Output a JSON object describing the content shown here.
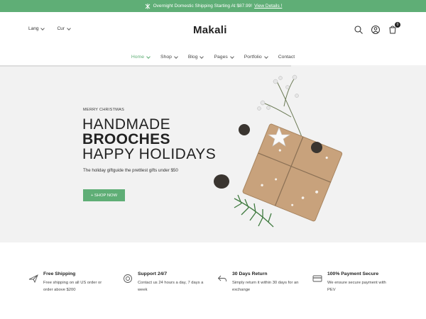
{
  "topbar": {
    "text": "Overnight Domestic Shipping Starting At $87.99!",
    "link": "View Details !"
  },
  "header": {
    "lang_label": "Lang",
    "cur_label": "Cur",
    "logo": "Makali",
    "cart_count": "0"
  },
  "nav": {
    "items": [
      {
        "label": "Home"
      },
      {
        "label": "Shop"
      },
      {
        "label": "Blog"
      },
      {
        "label": "Pages"
      },
      {
        "label": "Portfolio"
      },
      {
        "label": "Contact"
      }
    ]
  },
  "hero": {
    "eyebrow": "MERRY CHRISTMAS",
    "line1": "HANDMADE",
    "line2": "BROOCHES",
    "line3": "HAPPY HOLIDAYS",
    "subtitle": "The holiday giftguide the prettlest gifts under $50",
    "cta": "+ SHOP NOW"
  },
  "features": [
    {
      "title": "Free Shipping",
      "desc": "Free shipping on all US order or order above $200",
      "icon": "plane-icon"
    },
    {
      "title": "Support 24/7",
      "desc": "Contact us 24 hours a day, 7 days a week",
      "icon": "support-icon"
    },
    {
      "title": "30 Days Return",
      "desc": "Simply return it within 30 days for an exchange",
      "icon": "return-icon"
    },
    {
      "title": "100% Payment Secure",
      "desc": "We ensure secure payment with PEV",
      "icon": "card-icon"
    }
  ],
  "colors": {
    "accent": "#5fae76"
  }
}
